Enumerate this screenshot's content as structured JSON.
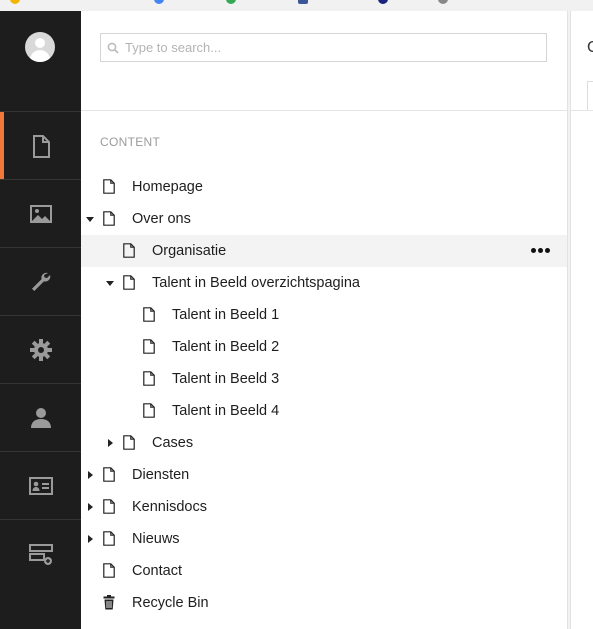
{
  "search": {
    "placeholder": "Type to search..."
  },
  "sections": [
    {
      "name": "content",
      "icon": "document-icon"
    },
    {
      "name": "media",
      "icon": "image-icon"
    },
    {
      "name": "settings",
      "icon": "wrench-icon"
    },
    {
      "name": "developer",
      "icon": "cog-icon"
    },
    {
      "name": "users",
      "icon": "user-icon"
    },
    {
      "name": "members",
      "icon": "id-card-icon"
    },
    {
      "name": "forms",
      "icon": "forms-icon"
    }
  ],
  "tree": {
    "title": "CONTENT",
    "items": [
      {
        "label": "Homepage",
        "depth": 0,
        "caret": "none",
        "icon": "document-icon"
      },
      {
        "label": "Over ons",
        "depth": 0,
        "caret": "open",
        "icon": "document-icon"
      },
      {
        "label": "Organisatie",
        "depth": 1,
        "caret": "none",
        "icon": "document-icon",
        "hovered": true
      },
      {
        "label": "Talent in Beeld overzichtspagina",
        "depth": 1,
        "caret": "open",
        "icon": "document-icon"
      },
      {
        "label": "Talent in Beeld 1",
        "depth": 2,
        "caret": "none",
        "icon": "document-icon"
      },
      {
        "label": "Talent in Beeld 2",
        "depth": 2,
        "caret": "none",
        "icon": "document-icon"
      },
      {
        "label": "Talent in Beeld 3",
        "depth": 2,
        "caret": "none",
        "icon": "document-icon"
      },
      {
        "label": "Talent in Beeld 4",
        "depth": 2,
        "caret": "none",
        "icon": "document-icon"
      },
      {
        "label": "Cases",
        "depth": 1,
        "caret": "closed",
        "icon": "document-icon"
      },
      {
        "label": "Diensten",
        "depth": 0,
        "caret": "closed",
        "icon": "document-icon"
      },
      {
        "label": "Kennisdocs",
        "depth": 0,
        "caret": "closed",
        "icon": "document-icon"
      },
      {
        "label": "Nieuws",
        "depth": 0,
        "caret": "closed",
        "icon": "document-icon"
      },
      {
        "label": "Contact",
        "depth": 0,
        "caret": "none",
        "icon": "document-icon"
      },
      {
        "label": "Recycle Bin",
        "depth": 0,
        "caret": "none",
        "icon": "trash-icon"
      }
    ]
  },
  "editor": {
    "heading_initial": "C"
  },
  "colors": {
    "nav_bg": "#1d1d1d",
    "accent": "#f0793a",
    "hover_row": "#f3f3f3"
  }
}
